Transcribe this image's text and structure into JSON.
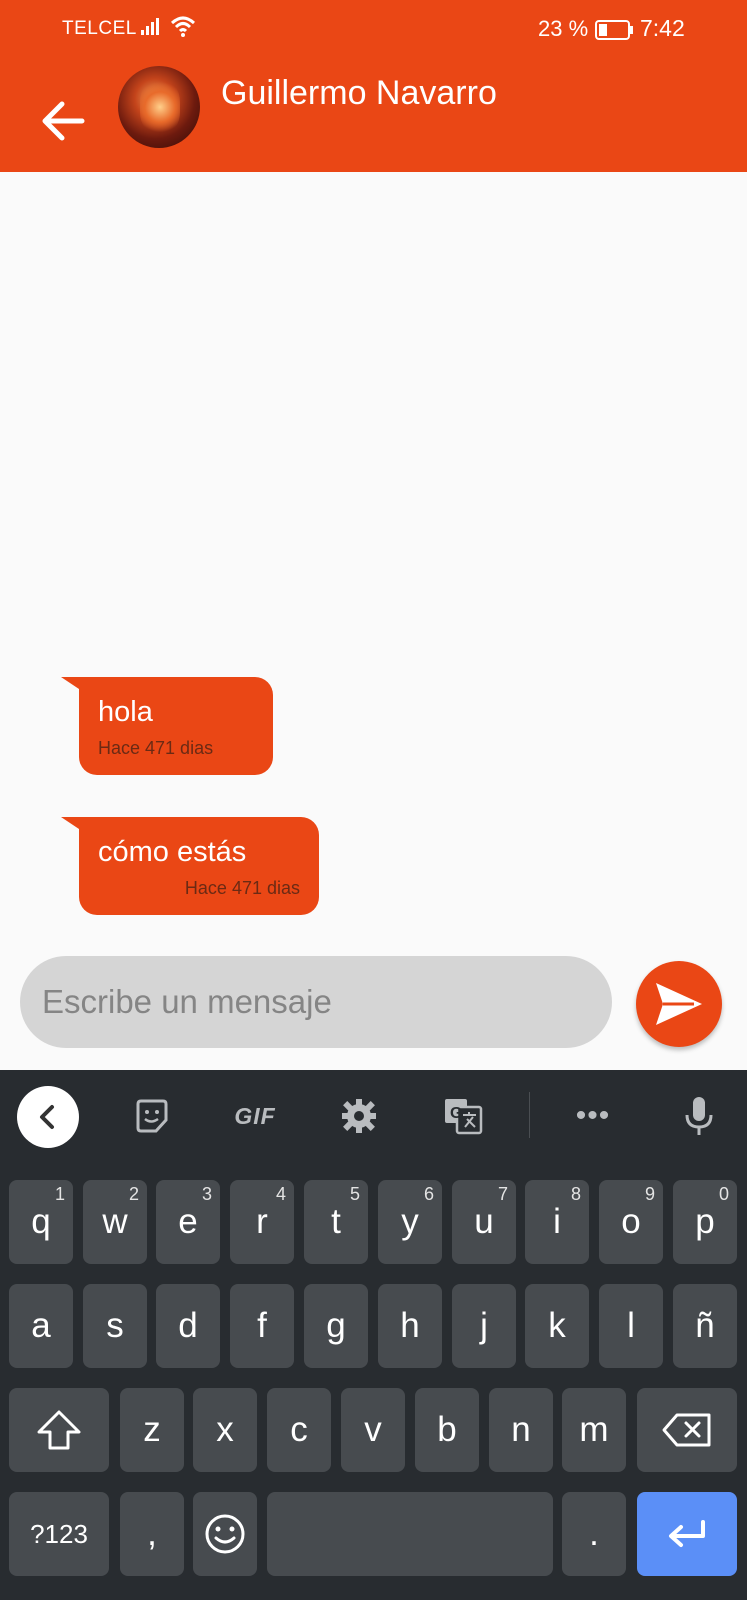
{
  "status_bar": {
    "carrier": "TELCEL",
    "battery_percent": "23 %",
    "time": "7:42"
  },
  "header": {
    "contact_name": "Guillermo Navarro",
    "back_icon": "arrow-left-icon",
    "avatar": "contact-avatar"
  },
  "messages": [
    {
      "text": "hola",
      "time": "Hace 471 dias"
    },
    {
      "text": "cómo estás",
      "time": "Hace 471 dias"
    }
  ],
  "composer": {
    "placeholder": "Escribe un mensaje",
    "send_icon": "send-icon"
  },
  "keyboard": {
    "toolbar": {
      "gif_label": "GIF",
      "more_label": "•••"
    },
    "row1": [
      {
        "key": "q",
        "num": "1"
      },
      {
        "key": "w",
        "num": "2"
      },
      {
        "key": "e",
        "num": "3"
      },
      {
        "key": "r",
        "num": "4"
      },
      {
        "key": "t",
        "num": "5"
      },
      {
        "key": "y",
        "num": "6"
      },
      {
        "key": "u",
        "num": "7"
      },
      {
        "key": "i",
        "num": "8"
      },
      {
        "key": "o",
        "num": "9"
      },
      {
        "key": "p",
        "num": "0"
      }
    ],
    "row2": [
      "a",
      "s",
      "d",
      "f",
      "g",
      "h",
      "j",
      "k",
      "l",
      "ñ"
    ],
    "row3": [
      "z",
      "x",
      "c",
      "v",
      "b",
      "n",
      "m"
    ],
    "bottom": {
      "symbols_label": "?123",
      "comma_label": ",",
      "period_label": "."
    }
  },
  "colors": {
    "accent": "#ea4715",
    "keyboard_bg": "#282c30",
    "key_bg": "#474b4f",
    "enter_key": "#5b8ff7"
  }
}
